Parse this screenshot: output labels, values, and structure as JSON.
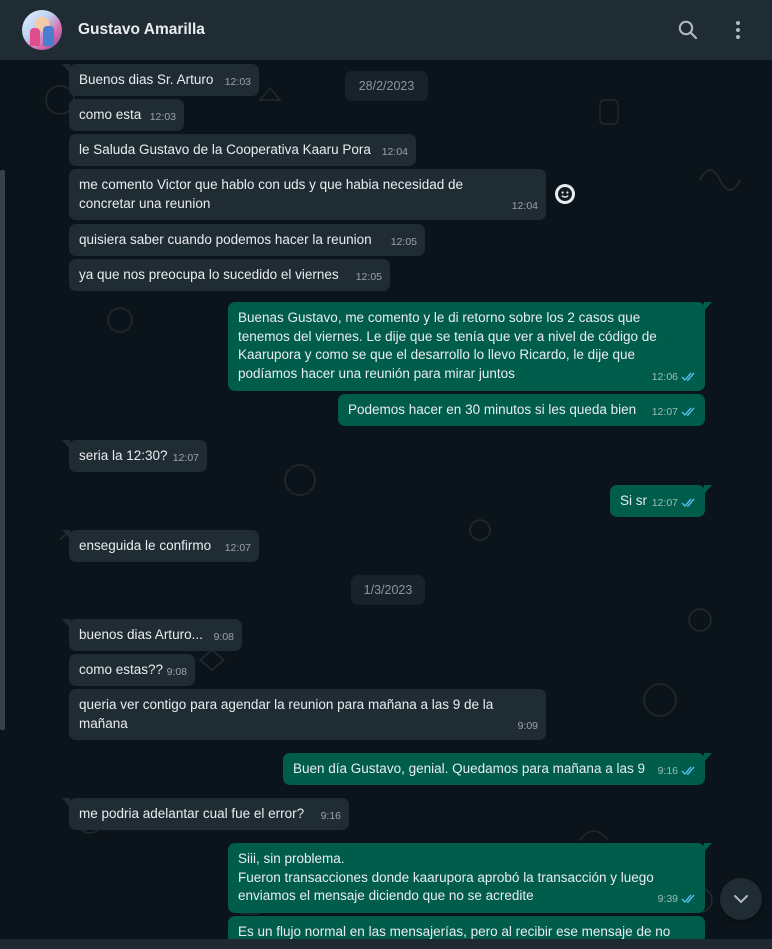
{
  "header": {
    "contact_name": "Gustavo Amarilla",
    "icons": [
      "avatar",
      "search-icon",
      "menu-dots-icon"
    ]
  },
  "colors": {
    "header_bg": "#202c33",
    "chat_bg": "#0b141a",
    "incoming_bubble": "#202c33",
    "outgoing_bubble": "#005c4b",
    "read_ticks": "#53bdeb"
  },
  "separators": [
    {
      "label": "28/2/2023"
    },
    {
      "label": "1/3/2023"
    }
  ],
  "messages": [
    {
      "dir": "in",
      "text": "Buenos dias Sr. Arturo",
      "time": "12:03"
    },
    {
      "dir": "in",
      "text": "como esta",
      "time": "12:03"
    },
    {
      "dir": "in",
      "text": "le Saluda Gustavo de la Cooperativa Kaaru Pora",
      "time": "12:04"
    },
    {
      "dir": "in",
      "text": "me comento Victor que hablo con uds y que habia necesidad de\nconcretar una reunion",
      "time": "12:04"
    },
    {
      "dir": "in",
      "text": "quisiera saber cuando podemos hacer la reunion",
      "time": "12:05"
    },
    {
      "dir": "in",
      "text": "ya que nos preocupa lo sucedido el viernes",
      "time": "12:05"
    },
    {
      "dir": "out",
      "text": "Buenas Gustavo, me comento y le di retorno sobre los 2 casos que\ntenemos del viernes. Le dije que se tenía que ver a nivel de código de\nKaarupora y como se que el desarrollo lo llevo Ricardo, le dije que\npodíamos hacer una reunión para mirar juntos",
      "time": "12:06"
    },
    {
      "dir": "out",
      "text": "Podemos hacer en 30 minutos si les queda bien",
      "time": "12:07"
    },
    {
      "dir": "in",
      "text": "seria la 12:30?",
      "time": "12:07"
    },
    {
      "dir": "out",
      "text": "Si sr",
      "time": "12:07"
    },
    {
      "dir": "in",
      "text": "enseguida le confirmo",
      "time": "12:07"
    },
    {
      "dir": "in",
      "text": "buenos dias Arturo...",
      "time": "9:08"
    },
    {
      "dir": "in",
      "text": "como estas??",
      "time": "9:08"
    },
    {
      "dir": "in",
      "text": "queria ver contigo para agendar la reunion para mañana a las 9 de la\nmañana",
      "time": "9:09"
    },
    {
      "dir": "out",
      "text": "Buen día Gustavo, genial. Quedamos para mañana a las 9",
      "time": "9:16"
    },
    {
      "dir": "in",
      "text": "me podria adelantar cual fue el error?",
      "time": "9:16"
    },
    {
      "dir": "out",
      "text": "Siii, sin problema.\nFueron transacciones donde kaarupora aprobó la transacción y luego\nenviamos el mensaje diciendo que no se acredite",
      "time": "9:39"
    },
    {
      "dir": "out",
      "text": "Es un flujo normal en las mensajerías, pero al recibir ese mensaje de no",
      "time": ""
    }
  ]
}
